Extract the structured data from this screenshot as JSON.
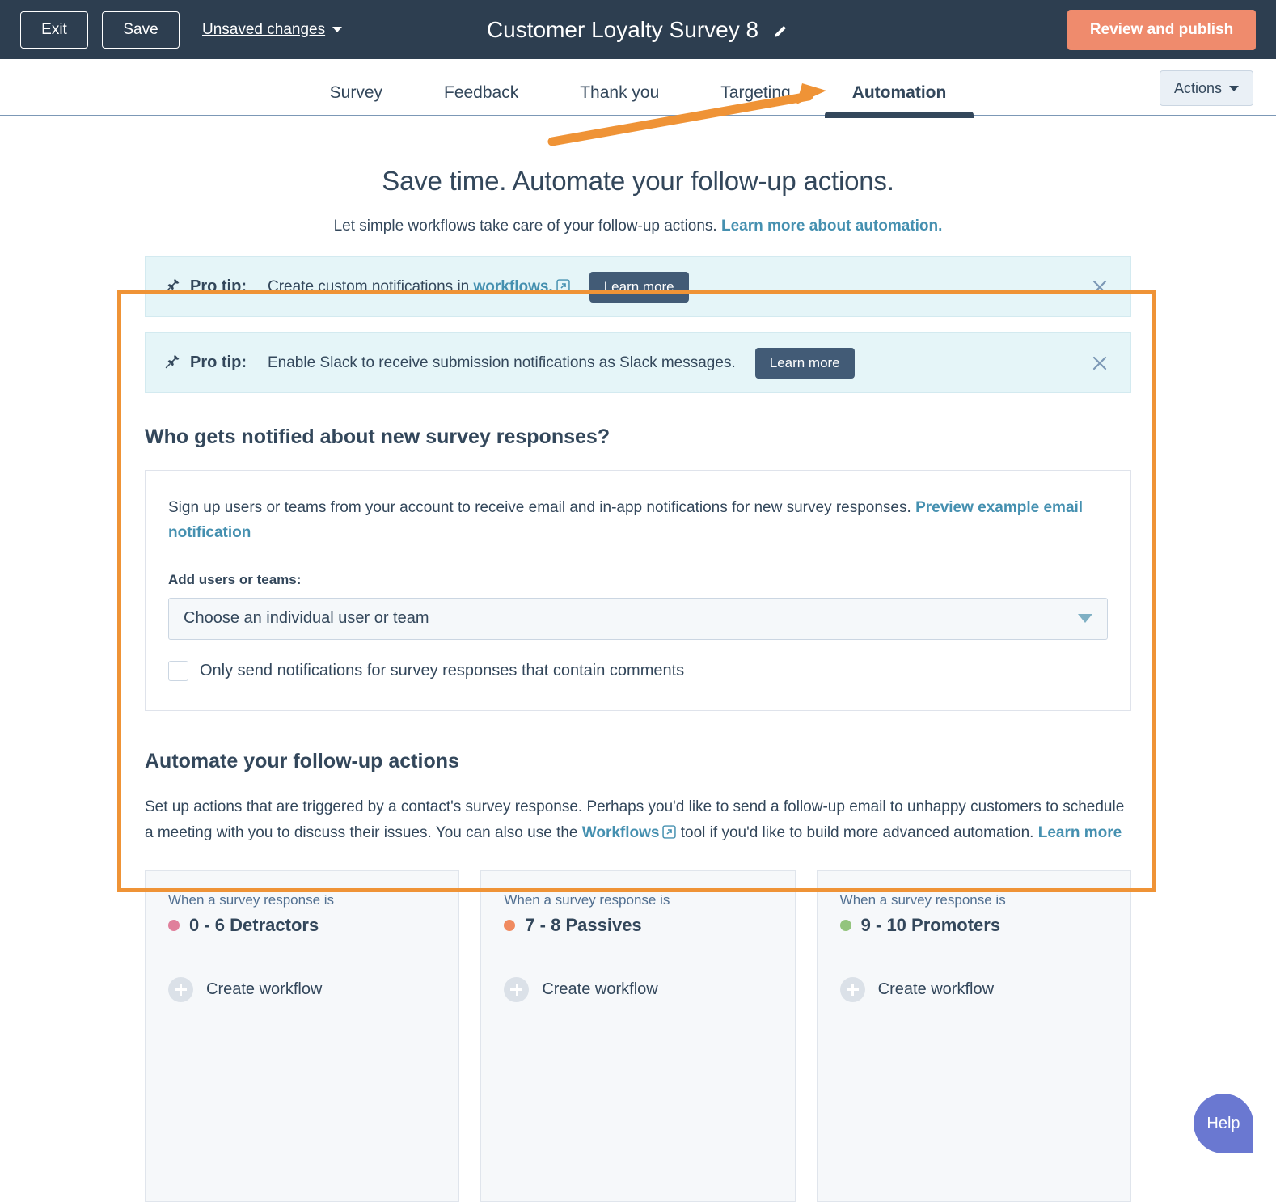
{
  "topbar": {
    "exit_label": "Exit",
    "save_label": "Save",
    "unsaved_label": "Unsaved changes",
    "survey_title": "Customer Loyalty Survey 8",
    "edit_icon": "pencil-icon",
    "publish_label": "Review and publish",
    "bg_color": "#2d3e50",
    "publish_color": "#ef8b6d"
  },
  "tabs": {
    "items": [
      {
        "label": "Survey",
        "active": false
      },
      {
        "label": "Feedback",
        "active": false
      },
      {
        "label": "Thank you",
        "active": false
      },
      {
        "label": "Targeting",
        "active": false
      },
      {
        "label": "Automation",
        "active": true
      }
    ],
    "actions_label": "Actions"
  },
  "hero": {
    "title": "Save time. Automate your follow-up actions.",
    "subtitle_text": "Let simple workflows take care of your follow-up actions. ",
    "subtitle_link": "Learn more about automation."
  },
  "banners": [
    {
      "pin_icon": "pin-icon",
      "label": "Pro tip:",
      "text_before": "Create custom notifications in ",
      "link": "workflows.",
      "has_ext_icon": true,
      "text_after": "",
      "button": "Learn more",
      "close_icon": "close-icon"
    },
    {
      "pin_icon": "pin-icon",
      "label": "Pro tip:",
      "text_before": "Enable Slack to receive submission notifications as Slack messages.",
      "link": "",
      "has_ext_icon": false,
      "text_after": "",
      "button": "Learn more",
      "close_icon": "close-icon"
    }
  ],
  "notify": {
    "heading": "Who gets notified about new survey responses?",
    "body_text": "Sign up users or teams from your account to receive email and in-app notifications for new survey responses. ",
    "body_link": "Preview example email notification",
    "field_label": "Add users or teams:",
    "select_value": "Choose an individual user or team",
    "checkbox_label": "Only send notifications for survey responses that contain comments",
    "checkbox_checked": false
  },
  "automate": {
    "heading": "Automate your follow-up actions",
    "para_1": "Set up actions that are triggered by a contact's survey response. Perhaps you'd like to send a follow-up email to unhappy customers to schedule a meeting with you to discuss their issues. You can also use the ",
    "workflows_link": "Workflows",
    "para_2": " tool if you'd like to build more advanced automation. ",
    "learn_more_link": "Learn more"
  },
  "cards": [
    {
      "sub": "When a survey response is",
      "title": "0 - 6 Detractors",
      "dot_color": "#e07f9b",
      "action": "Create workflow"
    },
    {
      "sub": "When a survey response is",
      "title": "7 - 8 Passives",
      "dot_color": "#f08a5f",
      "action": "Create workflow"
    },
    {
      "sub": "When a survey response is",
      "title": "9 - 10 Promoters",
      "dot_color": "#93c47d",
      "action": "Create workflow"
    }
  ],
  "help": {
    "label": "Help",
    "color": "#6a78d1"
  },
  "annotation": {
    "arrow_color": "#ef9336",
    "highlight_color": "#ef9336"
  }
}
